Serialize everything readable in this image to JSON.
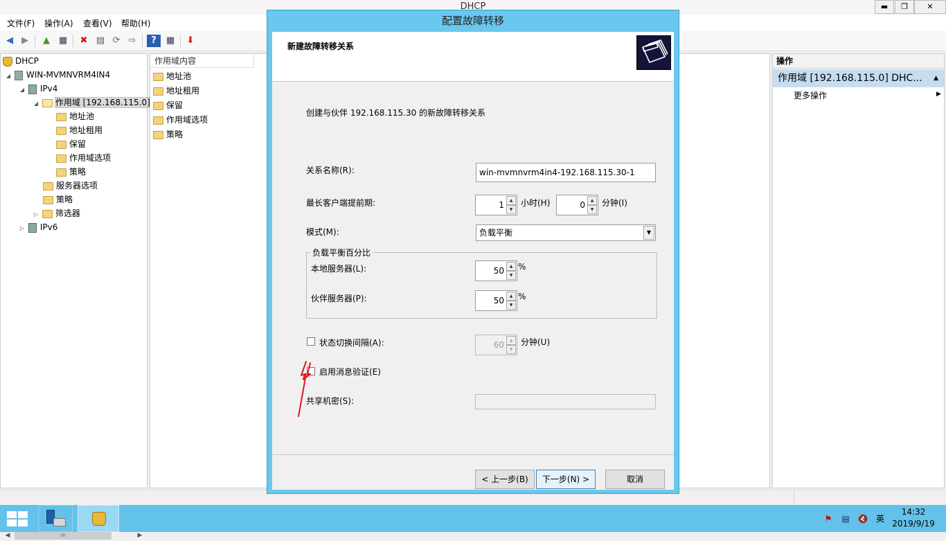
{
  "window": {
    "title": "DHCP"
  },
  "menu": [
    "文件(F)",
    "操作(A)",
    "查看(V)",
    "帮助(H)"
  ],
  "tree": {
    "root": "DHCP",
    "server": "WIN-MVMNVRM4IN4",
    "ipv4": "IPv4",
    "scope": "作用域 [192.168.115.0]",
    "scope_children": [
      "地址池",
      "地址租用",
      "保留",
      "作用域选项",
      "策略"
    ],
    "server_options": "服务器选项",
    "policies": "策略",
    "filters": "筛选器",
    "ipv6": "IPv6",
    "scroll_grip": "III"
  },
  "content": {
    "column_header": "作用域内容",
    "items": [
      "地址池",
      "地址租用",
      "保留",
      "作用域选项",
      "策略"
    ]
  },
  "actions": {
    "header": "操作",
    "scope": "作用域 [192.168.115.0] DHC...",
    "more": "更多操作"
  },
  "dialog": {
    "title": "配置故障转移",
    "header": "新建故障转移关系",
    "description": "创建与伙伴 192.168.115.30 的新故障转移关系",
    "relationship_label": "关系名称(R):",
    "relationship_value": "win-mvmnvrm4in4-192.168.115.30-1",
    "mclt_label": "最长客户端提前期:",
    "mclt_hours": "1",
    "hours_unit": "小时(H)",
    "mclt_minutes": "0",
    "minutes_unit": "分钟(I)",
    "mode_label": "模式(M):",
    "mode_value": "负载平衡",
    "lb_group": "负载平衡百分比",
    "local_label": "本地服务器(L):",
    "local_value": "50",
    "partner_label": "伙伴服务器(P):",
    "partner_value": "50",
    "percent": "%",
    "state_switch_label": "状态切换间隔(A):",
    "state_switch_value": "60",
    "state_switch_unit": "分钟(U)",
    "auth_label": "启用消息验证(E)",
    "secret_label": "共享机密(S):",
    "back_button": "< 上一步(B)",
    "next_button": "下一步(N) >",
    "cancel_button": "取消"
  },
  "taskbar": {
    "ime": "英",
    "time": "14:32",
    "date": "2019/9/19"
  },
  "colors": {
    "dialog_frame": "#6ac8ee",
    "taskbar": "#63c2ea",
    "annotation_arrow": "#e0141e"
  }
}
